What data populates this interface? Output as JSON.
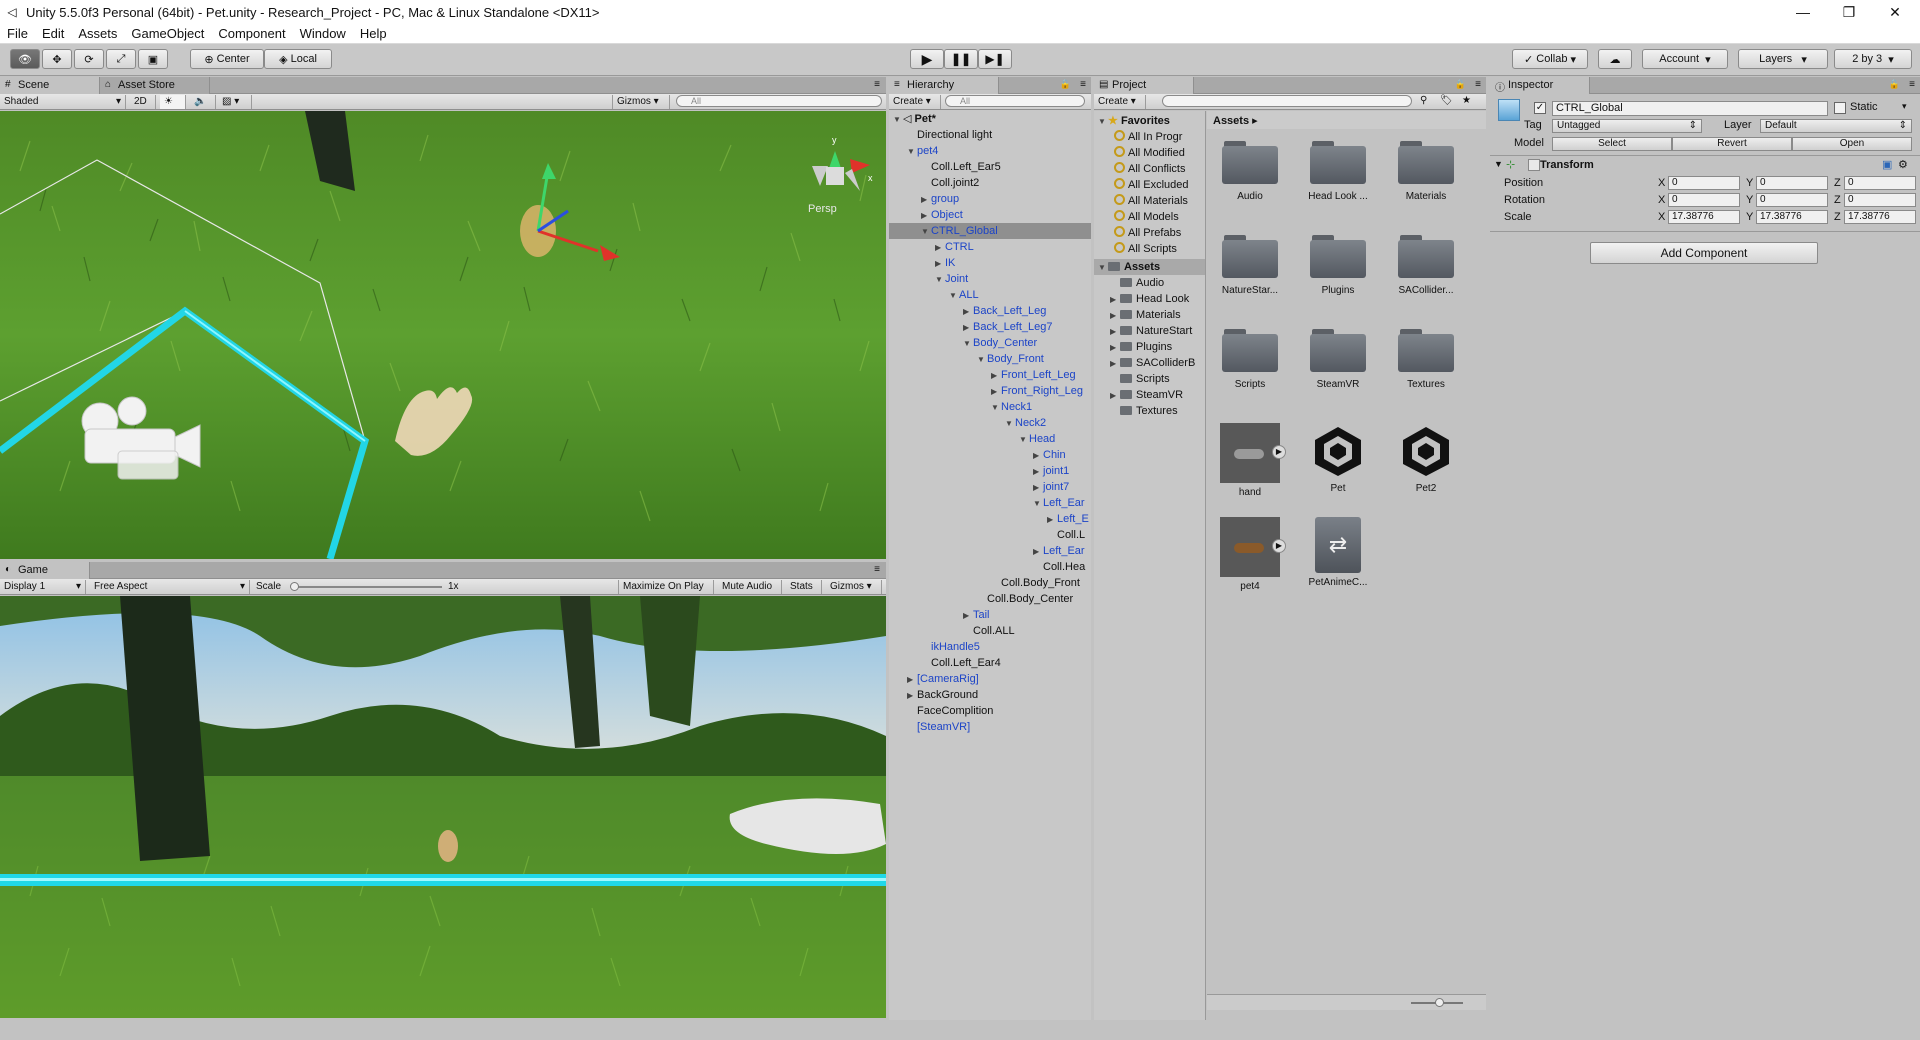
{
  "window": {
    "title": "Unity 5.5.0f3 Personal (64bit) - Pet.unity - Research_Project - PC, Mac & Linux Standalone <DX11>"
  },
  "menu": [
    "File",
    "Edit",
    "Assets",
    "GameObject",
    "Component",
    "Window",
    "Help"
  ],
  "toolbar": {
    "center_label": "Center",
    "local_label": "Local",
    "collab_label": "Collab",
    "account_label": "Account",
    "layers_label": "Layers",
    "layout_label": "2 by 3"
  },
  "scene": {
    "tab_label": "Scene",
    "asset_store_label": "Asset Store",
    "shading": "Shaded",
    "mode_2d": "2D",
    "gizmos": "Gizmos",
    "search_placeholder": "All",
    "persp_label": "Persp"
  },
  "game": {
    "tab_label": "Game",
    "display": "Display 1",
    "aspect": "Free Aspect",
    "scale_label": "Scale",
    "scale_value": "1x",
    "maximize": "Maximize On Play",
    "mute": "Mute Audio",
    "stats": "Stats",
    "gizmos": "Gizmos"
  },
  "hierarchy": {
    "tab_label": "Hierarchy",
    "create": "Create",
    "search_placeholder": "All",
    "items": [
      {
        "label": "Pet*",
        "depth": 0,
        "fold": "open",
        "blue": false,
        "bold": true
      },
      {
        "label": "Directional light",
        "depth": 1,
        "fold": "",
        "blue": false
      },
      {
        "label": "pet4",
        "depth": 1,
        "fold": "open",
        "blue": true
      },
      {
        "label": "Coll.Left_Ear5",
        "depth": 2,
        "fold": "",
        "blue": false
      },
      {
        "label": "Coll.joint2",
        "depth": 2,
        "fold": "",
        "blue": false
      },
      {
        "label": "group",
        "depth": 2,
        "fold": "closed",
        "blue": true
      },
      {
        "label": "Object",
        "depth": 2,
        "fold": "closed",
        "blue": true
      },
      {
        "label": "CTRL_Global",
        "depth": 2,
        "fold": "open",
        "blue": true,
        "selected": true
      },
      {
        "label": "CTRL",
        "depth": 3,
        "fold": "closed",
        "blue": true
      },
      {
        "label": "IK",
        "depth": 3,
        "fold": "closed",
        "blue": true
      },
      {
        "label": "Joint",
        "depth": 3,
        "fold": "open",
        "blue": true
      },
      {
        "label": "ALL",
        "depth": 4,
        "fold": "open",
        "blue": true
      },
      {
        "label": "Back_Left_Leg",
        "depth": 5,
        "fold": "closed",
        "blue": true
      },
      {
        "label": "Back_Left_Leg7",
        "depth": 5,
        "fold": "closed",
        "blue": true
      },
      {
        "label": "Body_Center",
        "depth": 5,
        "fold": "open",
        "blue": true
      },
      {
        "label": "Body_Front",
        "depth": 6,
        "fold": "open",
        "blue": true
      },
      {
        "label": "Front_Left_Leg",
        "depth": 7,
        "fold": "closed",
        "blue": true
      },
      {
        "label": "Front_Right_Leg",
        "depth": 7,
        "fold": "closed",
        "blue": true
      },
      {
        "label": "Neck1",
        "depth": 7,
        "fold": "open",
        "blue": true
      },
      {
        "label": "Neck2",
        "depth": 8,
        "fold": "open",
        "blue": true
      },
      {
        "label": "Head",
        "depth": 9,
        "fold": "open",
        "blue": true
      },
      {
        "label": "Chin",
        "depth": 10,
        "fold": "closed",
        "blue": true
      },
      {
        "label": "joint1",
        "depth": 10,
        "fold": "closed",
        "blue": true
      },
      {
        "label": "joint7",
        "depth": 10,
        "fold": "closed",
        "blue": true
      },
      {
        "label": "Left_Ear",
        "depth": 10,
        "fold": "open",
        "blue": true
      },
      {
        "label": "Left_E",
        "depth": 11,
        "fold": "closed",
        "blue": true
      },
      {
        "label": "Coll.L",
        "depth": 11,
        "fold": "",
        "blue": false
      },
      {
        "label": "Left_Ear",
        "depth": 10,
        "fold": "closed",
        "blue": true
      },
      {
        "label": "Coll.Hea",
        "depth": 10,
        "fold": "",
        "blue": false
      },
      {
        "label": "Coll.Body_Front",
        "depth": 7,
        "fold": "",
        "blue": false
      },
      {
        "label": "Coll.Body_Center",
        "depth": 6,
        "fold": "",
        "blue": false
      },
      {
        "label": "Tail",
        "depth": 5,
        "fold": "closed",
        "blue": true
      },
      {
        "label": "Coll.ALL",
        "depth": 5,
        "fold": "",
        "blue": false
      },
      {
        "label": "ikHandle5",
        "depth": 2,
        "fold": "",
        "blue": true
      },
      {
        "label": "Coll.Left_Ear4",
        "depth": 2,
        "fold": "",
        "blue": false
      },
      {
        "label": "[CameraRig]",
        "depth": 1,
        "fold": "closed",
        "blue": true
      },
      {
        "label": "BackGround",
        "depth": 1,
        "fold": "closed",
        "blue": false
      },
      {
        "label": "FaceComplition",
        "depth": 1,
        "fold": "",
        "blue": false
      },
      {
        "label": "[SteamVR]",
        "depth": 1,
        "fold": "",
        "blue": true
      }
    ]
  },
  "project": {
    "tab_label": "Project",
    "create": "Create",
    "favorites_label": "Favorites",
    "assets_label": "Assets",
    "breadcrumb": "Assets",
    "favorites": [
      "All In Progr",
      "All Modified",
      "All Conflicts",
      "All Excluded",
      "All Materials",
      "All Models",
      "All Prefabs",
      "All Scripts"
    ],
    "folders": [
      "Audio",
      "Head Look",
      "Materials",
      "NatureStart",
      "Plugins",
      "SAColliderB",
      "Scripts",
      "SteamVR",
      "Textures"
    ],
    "folder_arrows": [
      false,
      true,
      true,
      true,
      true,
      true,
      false,
      true,
      false
    ],
    "grid": [
      {
        "label": "Audio",
        "kind": "folder"
      },
      {
        "label": "Head Look ...",
        "kind": "folder"
      },
      {
        "label": "Materials",
        "kind": "folder"
      },
      {
        "label": "NatureStar...",
        "kind": "folder"
      },
      {
        "label": "Plugins",
        "kind": "folder"
      },
      {
        "label": "SACollider...",
        "kind": "folder"
      },
      {
        "label": "Scripts",
        "kind": "folder"
      },
      {
        "label": "SteamVR",
        "kind": "folder"
      },
      {
        "label": "Textures",
        "kind": "folder"
      },
      {
        "label": "hand",
        "kind": "model"
      },
      {
        "label": "Pet",
        "kind": "unity"
      },
      {
        "label": "Pet2",
        "kind": "unity"
      },
      {
        "label": "pet4",
        "kind": "model2"
      },
      {
        "label": "PetAnimeC...",
        "kind": "anim"
      }
    ]
  },
  "inspector": {
    "tab_label": "Inspector",
    "object_name": "CTRL_Global",
    "static_label": "Static",
    "tag_label": "Tag",
    "tag_value": "Untagged",
    "layer_label": "Layer",
    "layer_value": "Default",
    "model_label": "Model",
    "select": "Select",
    "revert": "Revert",
    "open": "Open",
    "transform_label": "Transform",
    "position_label": "Position",
    "rotation_label": "Rotation",
    "scale_label": "Scale",
    "position": {
      "x": "0",
      "y": "0",
      "z": "0"
    },
    "rotation": {
      "x": "0",
      "y": "0",
      "z": "0"
    },
    "scale": {
      "x": "17.38776",
      "y": "17.38776",
      "z": "17.38776"
    },
    "add_component": "Add Component"
  }
}
